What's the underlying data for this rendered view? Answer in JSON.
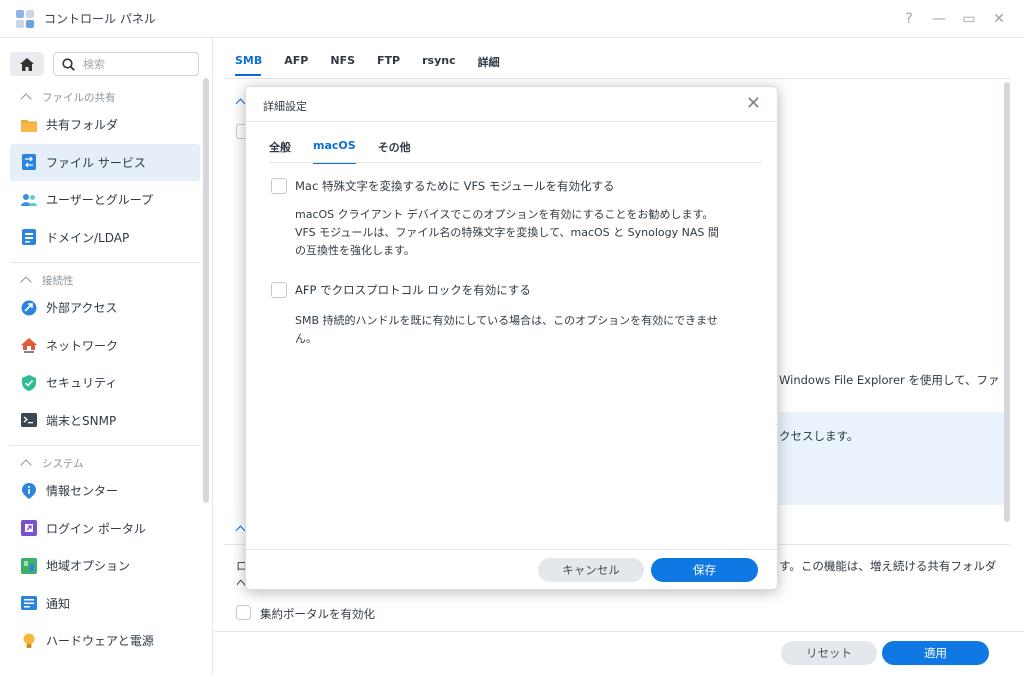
{
  "window": {
    "title": "コントロール パネル",
    "controls": [
      "?",
      "—",
      "▭",
      "✕"
    ]
  },
  "sidebar": {
    "search_placeholder": "検索",
    "sections": [
      {
        "title": "ファイルの共有",
        "items": [
          {
            "label": "共有フォルダ",
            "icon": "shared-folder-icon",
            "active": false
          },
          {
            "label": "ファイル サービス",
            "icon": "file-services-icon",
            "active": true
          },
          {
            "label": "ユーザーとグループ",
            "icon": "user-group-icon",
            "active": false
          },
          {
            "label": "ドメイン/LDAP",
            "icon": "domain-ldap-icon",
            "active": false
          }
        ]
      },
      {
        "title": "接続性",
        "items": [
          {
            "label": "外部アクセス",
            "icon": "external-access-icon",
            "active": false
          },
          {
            "label": "ネットワーク",
            "icon": "network-icon",
            "active": false
          },
          {
            "label": "セキュリティ",
            "icon": "security-shield-icon",
            "active": false
          },
          {
            "label": "端末とSNMP",
            "icon": "terminal-icon",
            "active": false
          }
        ]
      },
      {
        "title": "システム",
        "items": [
          {
            "label": "情報センター",
            "icon": "info-center-icon",
            "active": false
          },
          {
            "label": "ログイン ポータル",
            "icon": "login-portal-icon",
            "active": false
          },
          {
            "label": "地域オプション",
            "icon": "regional-options-icon",
            "active": false
          },
          {
            "label": "通知",
            "icon": "notification-icon",
            "active": false
          },
          {
            "label": "ハードウェアと電源",
            "icon": "hardware-power-icon",
            "active": false
          }
        ]
      }
    ]
  },
  "main": {
    "tabs": [
      "SMB",
      "AFP",
      "NFS",
      "FTP",
      "rsync",
      "詳細"
    ],
    "active_tab": "SMB",
    "background_text": {
      "line1": "Windows File Explorer を使用して、ファ",
      "line2": "クセスします。",
      "line3": "す。この機能は、増え続ける共有フォルダ",
      "line3_left": "ロ",
      "line4_left": "へ",
      "checkbox_label": "集約ポータルを有効化"
    },
    "reset_label": "リセット",
    "apply_label": "適用"
  },
  "dialog": {
    "title": "詳細設定",
    "tabs": [
      "全般",
      "macOS",
      "その他"
    ],
    "active_tab": "macOS",
    "options": [
      {
        "label": "Mac 特殊文字を変換するために VFS モジュールを有効化する",
        "checked": false,
        "description": [
          "macOS クライアント デバイスでこのオプションを有効にすることをお勧めします。",
          "VFS モジュールは、ファイル名の特殊文字を変換して、macOS と Synology NAS 間",
          "の互換性を強化します。"
        ]
      },
      {
        "label": "AFP でクロスプロトコル ロックを有効にする",
        "checked": false,
        "description": [
          "SMB 持続的ハンドルを既に有効にしている場合は、このオプションを有効にできませ",
          "ん。"
        ]
      }
    ],
    "cancel_label": "キャンセル",
    "save_label": "保存"
  },
  "colors": {
    "accent": "#0a6fd2",
    "primary_button": "#0f78e3",
    "active_nav_bg": "#e6eef8"
  }
}
